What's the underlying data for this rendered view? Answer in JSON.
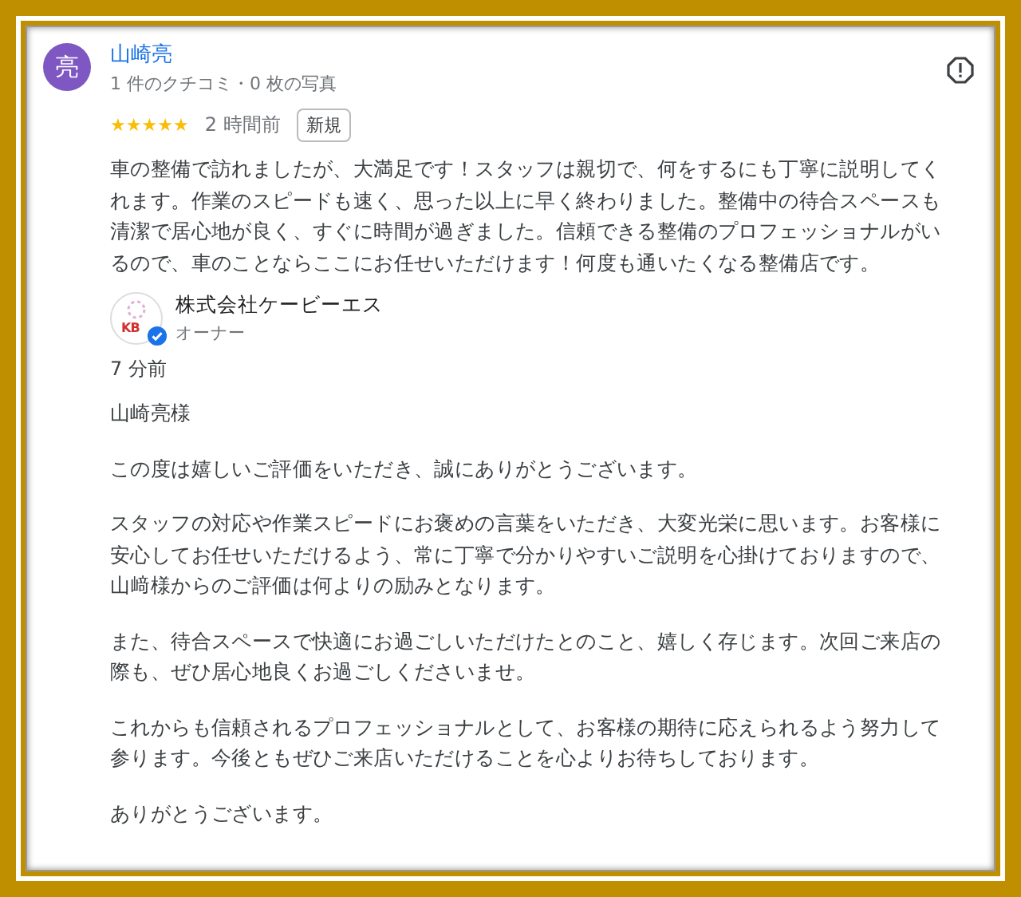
{
  "review": {
    "avatar_letter": "亮",
    "author": "山崎亮",
    "meta": "1 件のクチコミ・0 枚の写真",
    "stars": 5,
    "time": "2 時間前",
    "badge": "新規",
    "text": "車の整備で訪れましたが、大満足です！スタッフは親切で、何をするにも丁寧に説明してくれます。作業のスピードも速く、思った以上に早く終わりました。整備中の待合スペースも清潔で居心地が良く、すぐに時間が過ぎました。信頼できる整備のプロフェッショナルがいるので、車のことならここにお任せいただけます！何度も通いたくなる整備店です。"
  },
  "owner_reply": {
    "logo_text": "KB",
    "verified": true,
    "name": "株式会社ケービーエス",
    "role": "オーナー",
    "time": "7 分前",
    "paragraphs": [
      "山崎亮様",
      "この度は嬉しいご評価をいただき、誠にありがとうございます。",
      "スタッフの対応や作業スピードにお褒めの言葉をいただき、大変光栄に思います。お客様に安心してお任せいただけるよう、常に丁寧で分かりやすいご説明を心掛けておりますので、山﨑様からのご評価は何よりの励みとなります。",
      "また、待合スペースで快適にお過ごしいただけたとのこと、嬉しく存じます。次回ご来店の際も、ぜひ居心地良くお過ごしくださいませ。",
      "これからも信頼されるプロフェッショナルとして、お客様の期待に応えられるよう努力して参ります。今後ともぜひご来店いただけることを心よりお待ちしております。",
      "ありがとうございます。"
    ]
  }
}
